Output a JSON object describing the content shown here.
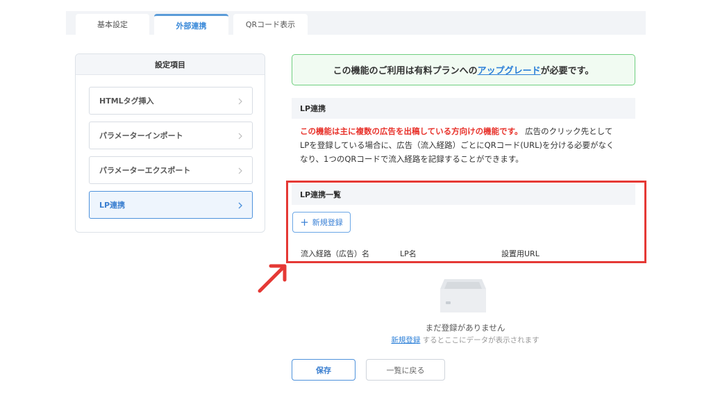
{
  "tabs": [
    {
      "label": "基本設定"
    },
    {
      "label": "外部連携"
    },
    {
      "label": "QRコード表示"
    }
  ],
  "sidebar": {
    "title": "設定項目",
    "items": [
      {
        "label": "HTMLタグ挿入"
      },
      {
        "label": "パラメーターインポート"
      },
      {
        "label": "パラメーターエクスポート"
      },
      {
        "label": "LP連携"
      }
    ]
  },
  "notice": {
    "pre": "この機能のご利用は有料プランへの",
    "link": "アップグレード",
    "post": "が必要です。"
  },
  "lp_section": {
    "title": "LP連携",
    "highlight": "この機能は主に複数の広告を出稿している方向けの機能です。",
    "line1_rest": " 広告のクリック先として",
    "line2": "LPを登録している場合に、広告（流入経路）ごとにQRコード(URL)を分ける必要がなく",
    "line3": "なり、1つのQRコードで流入経路を記録することができます。"
  },
  "list_section": {
    "title": "LP連携一覧",
    "new_button": "新規登録",
    "columns": [
      "流入経路（広告）名",
      "LP名",
      "設置用URL"
    ]
  },
  "empty_state": {
    "message": "まだ登録がありません",
    "link": "新規登録",
    "suffix": " するとここにデータが表示されます"
  },
  "footer": {
    "save": "保存",
    "back": "一覧に戻る"
  },
  "colors": {
    "accent": "#3b82d6",
    "highlight_red": "#e8332c",
    "annotation_red": "#e53935",
    "notice_green": "#6fcf7f"
  },
  "icons": {
    "new_button": "plus-icon",
    "sidebar_item": "chevron-right-icon",
    "empty_state": "empty-tray-icon",
    "annotation": "annotation-arrow"
  }
}
